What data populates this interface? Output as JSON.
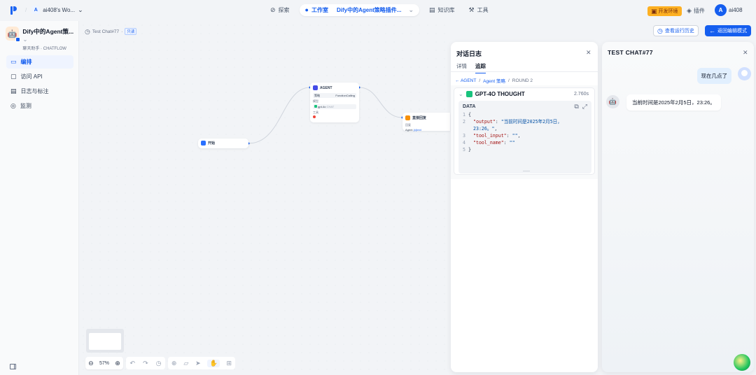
{
  "workspace": {
    "badge": "A",
    "name": "ai408's Wo..."
  },
  "nav": {
    "explore": "探索",
    "studio": "工作室",
    "app_name": "Dify中的Agent策略插件...",
    "knowledge": "知识库",
    "tools": "工具"
  },
  "env_badge": "开发环境",
  "plugins": "插件",
  "user": {
    "initial": "A",
    "name": "ai408"
  },
  "app": {
    "title": "Dify中的Agent策...",
    "type": "聊天助手",
    "mode": "CHATFLOW"
  },
  "sidebar": {
    "items": [
      {
        "label": "编排",
        "icon": "orchestrate-icon",
        "active": true
      },
      {
        "label": "访问 API",
        "icon": "api-icon",
        "active": false
      },
      {
        "label": "日志与标注",
        "icon": "logs-icon",
        "active": false
      },
      {
        "label": "监测",
        "icon": "monitor-icon",
        "active": false
      }
    ]
  },
  "canvas": {
    "breadcrumb": "Test Chat#77",
    "tag": "只读",
    "nodes": {
      "start": {
        "label": "开始"
      },
      "agent": {
        "label": "AGENT",
        "strategy_label": "策略",
        "strategy_value": "FunctionCalling",
        "model_section": "模型",
        "model_name": "gpt-4o",
        "model_tag": "CHAT",
        "tools_section": "工具"
      },
      "answer": {
        "label": "直接回复",
        "sub_label": "回复",
        "ref": "Agent",
        "ref_tag": "{x}text"
      }
    },
    "zoom": "57%"
  },
  "actions": {
    "history": "查看运行历史",
    "back": "返回编辑模式"
  },
  "log_panel": {
    "title": "对话日志",
    "tabs": [
      "详情",
      "追踪"
    ],
    "active_tab": 1,
    "trace": {
      "back": "AGENT",
      "strategy": "Agent 策略",
      "round": "ROUND 2"
    },
    "thought": {
      "title": "GPT-4O THOUGHT",
      "time": "2.760s",
      "data_label": "DATA",
      "lines": [
        {
          "n": "1",
          "text": "{"
        },
        {
          "n": "2",
          "key": "\"output\"",
          "value": "\"当前时间是2025年2月5日，"
        },
        {
          "n": "",
          "value": "23:26。\"",
          "tail": ","
        },
        {
          "n": "3",
          "key": "\"tool_input\"",
          "value": "\"\"",
          "tail": ","
        },
        {
          "n": "4",
          "key": "\"tool_name\"",
          "value": "\"\""
        },
        {
          "n": "5",
          "text": "}"
        }
      ]
    }
  },
  "chat_panel": {
    "title": "TEST CHAT#77",
    "question": "现在几点了",
    "answer": "当前时间是2025年2月5日，23:26。"
  }
}
